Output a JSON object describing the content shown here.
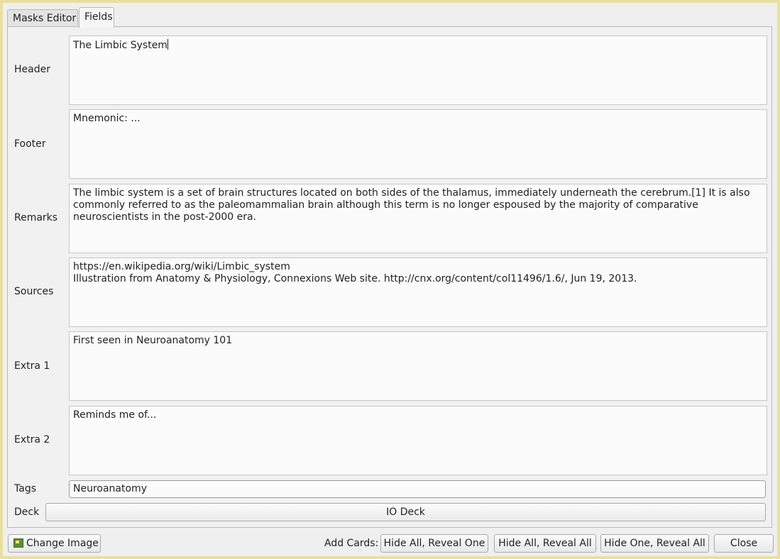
{
  "tabs": [
    {
      "label": "Masks Editor",
      "active": false
    },
    {
      "label": "Fields",
      "active": true
    }
  ],
  "fields": [
    {
      "label": "Header",
      "value": "The Limbic System"
    },
    {
      "label": "Footer",
      "value": "Mnemonic: ..."
    },
    {
      "label": "Remarks",
      "value": "The limbic system is a set of brain structures located on both sides of the thalamus, immediately underneath the cerebrum.[1] It is also commonly referred to as the paleomammalian brain although this term is no longer espoused by the majority of comparative neuroscientists in the post-2000 era."
    },
    {
      "label": "Sources",
      "value": "https://en.wikipedia.org/wiki/Limbic_system\nIllustration from Anatomy & Physiology, Connexions Web site. http://cnx.org/content/col11496/1.6/, Jun 19, 2013."
    },
    {
      "label": "Extra 1",
      "value": "First seen in Neuroanatomy 101"
    },
    {
      "label": "Extra 2",
      "value": "Reminds me of..."
    }
  ],
  "tags": {
    "label": "Tags",
    "value": "Neuroanatomy"
  },
  "deck": {
    "label": "Deck",
    "value": "IO Deck"
  },
  "footer": {
    "change_image": "Change Image",
    "add_cards_label": "Add Cards:",
    "hide_all_reveal_one": "Hide All, Reveal One",
    "hide_all_reveal_all": "Hide All, Reveal All",
    "hide_one_reveal_all": "Hide One, Reveal All",
    "close": "Close"
  },
  "icons": {
    "change_image": "image-icon"
  },
  "colors": {
    "window_border": "#e8e0a0"
  }
}
